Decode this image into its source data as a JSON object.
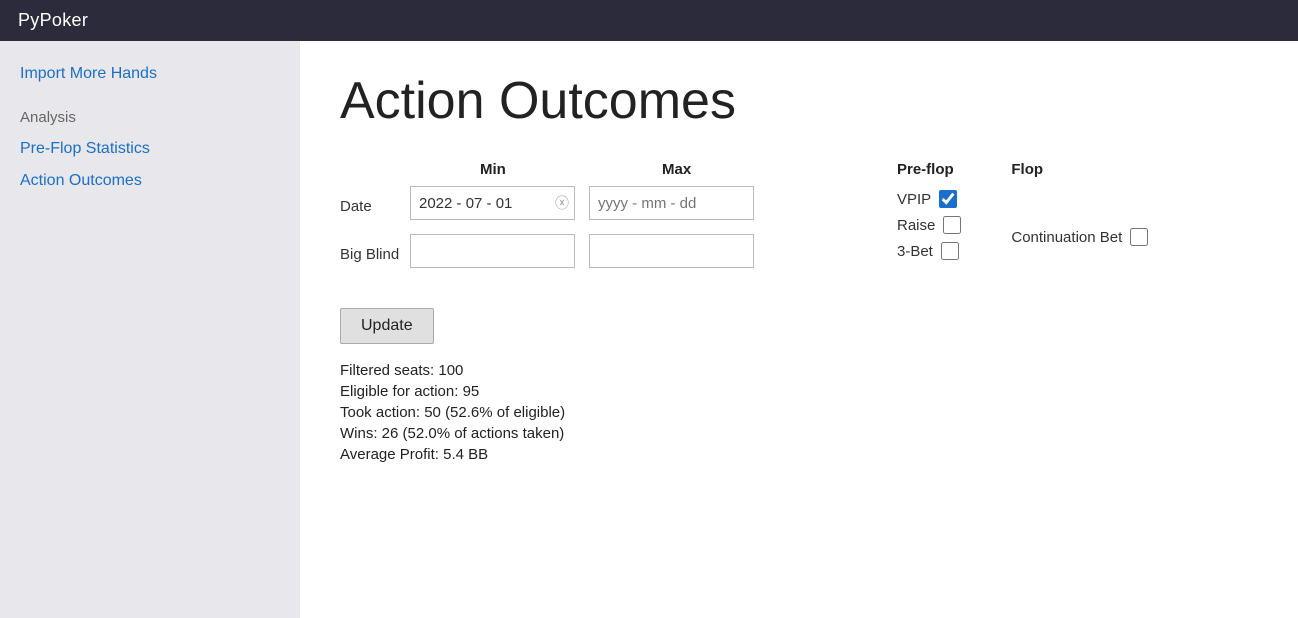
{
  "app": {
    "title": "PyPoker"
  },
  "sidebar": {
    "import_label": "Import More Hands",
    "analysis_label": "Analysis",
    "preflop_label": "Pre-Flop Statistics",
    "action_label": "Action Outcomes"
  },
  "main": {
    "page_title": "Action Outcomes",
    "filter": {
      "min_label": "Min",
      "max_label": "Max",
      "date_label": "Date",
      "bigblind_label": "Big Blind",
      "date_min_value": "2022 - 07 - 01",
      "date_max_placeholder": "yyyy - mm - dd",
      "bigblind_min_value": "",
      "bigblind_max_value": ""
    },
    "checkboxes": {
      "preflop_header": "Pre-flop",
      "flop_header": "Flop",
      "vpip_label": "VPIP",
      "vpip_checked": true,
      "raise_label": "Raise",
      "raise_checked": false,
      "threebet_label": "3-Bet",
      "threebet_checked": false,
      "contbet_label": "Continuation Bet",
      "contbet_checked": false
    },
    "update_button": "Update",
    "stats": {
      "filtered_seats": "Filtered seats: 100",
      "eligible": "Eligible for action: 95",
      "took_action": "Took action: 50 (52.6% of eligible)",
      "wins": "Wins: 26 (52.0% of actions taken)",
      "avg_profit": "Average Profit: 5.4 BB"
    }
  }
}
